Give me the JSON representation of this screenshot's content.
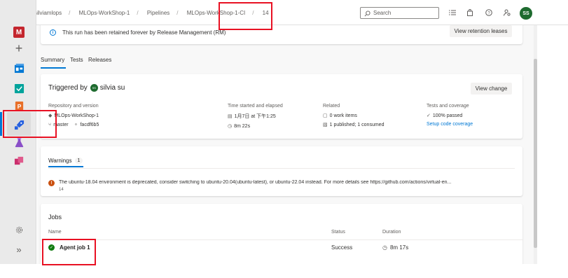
{
  "breadcrumb": {
    "org": "silviamlops",
    "project": "MLOps-WorkShop-1",
    "section": "Pipelines",
    "pipeline": "MLOps-WorkShop-1-CI",
    "run": "14"
  },
  "search": {
    "placeholder": "Search"
  },
  "user": {
    "initials": "SS"
  },
  "rail": {
    "project_letter": "M"
  },
  "retention": {
    "message": "This run has been retained forever by Release Management (RM)",
    "button": "View retention leases"
  },
  "tabs": [
    "Summary",
    "Tests",
    "Releases"
  ],
  "triggered": {
    "label": "Triggered by",
    "user": "silvia su",
    "avatar": "SS",
    "button": "View change",
    "repo_header": "Repository and version",
    "repo": "MLOps-WorkShop-1",
    "branch": "master",
    "commit": "facdf6b5",
    "time_header": "Time started and elapsed",
    "started": "1月7日 at 下午1:25",
    "elapsed": "8m 22s",
    "related_header": "Related",
    "work_items": "0 work items",
    "published": "1 published; 1 consumed",
    "tests_header": "Tests and coverage",
    "passed": "100% passed",
    "coverage_link": "Setup code coverage"
  },
  "warnings": {
    "title": "Warnings",
    "count": "1",
    "message": "The ubuntu-18.04 environment is deprecated, consider switching to ubuntu-20.04(ubuntu-latest), or ubuntu-22.04 instead. For more details see https://github.com/actions/virtual-en...",
    "sub": "14"
  },
  "jobs": {
    "title": "Jobs",
    "col_name": "Name",
    "col_status": "Status",
    "col_duration": "Duration",
    "rows": [
      {
        "name": "Agent job 1",
        "status": "Success",
        "duration": "8m 17s"
      }
    ]
  },
  "colors": {
    "accent": "#0078d4",
    "success": "#107c10",
    "warning": "#ca5010",
    "annotation": "#e81123"
  }
}
